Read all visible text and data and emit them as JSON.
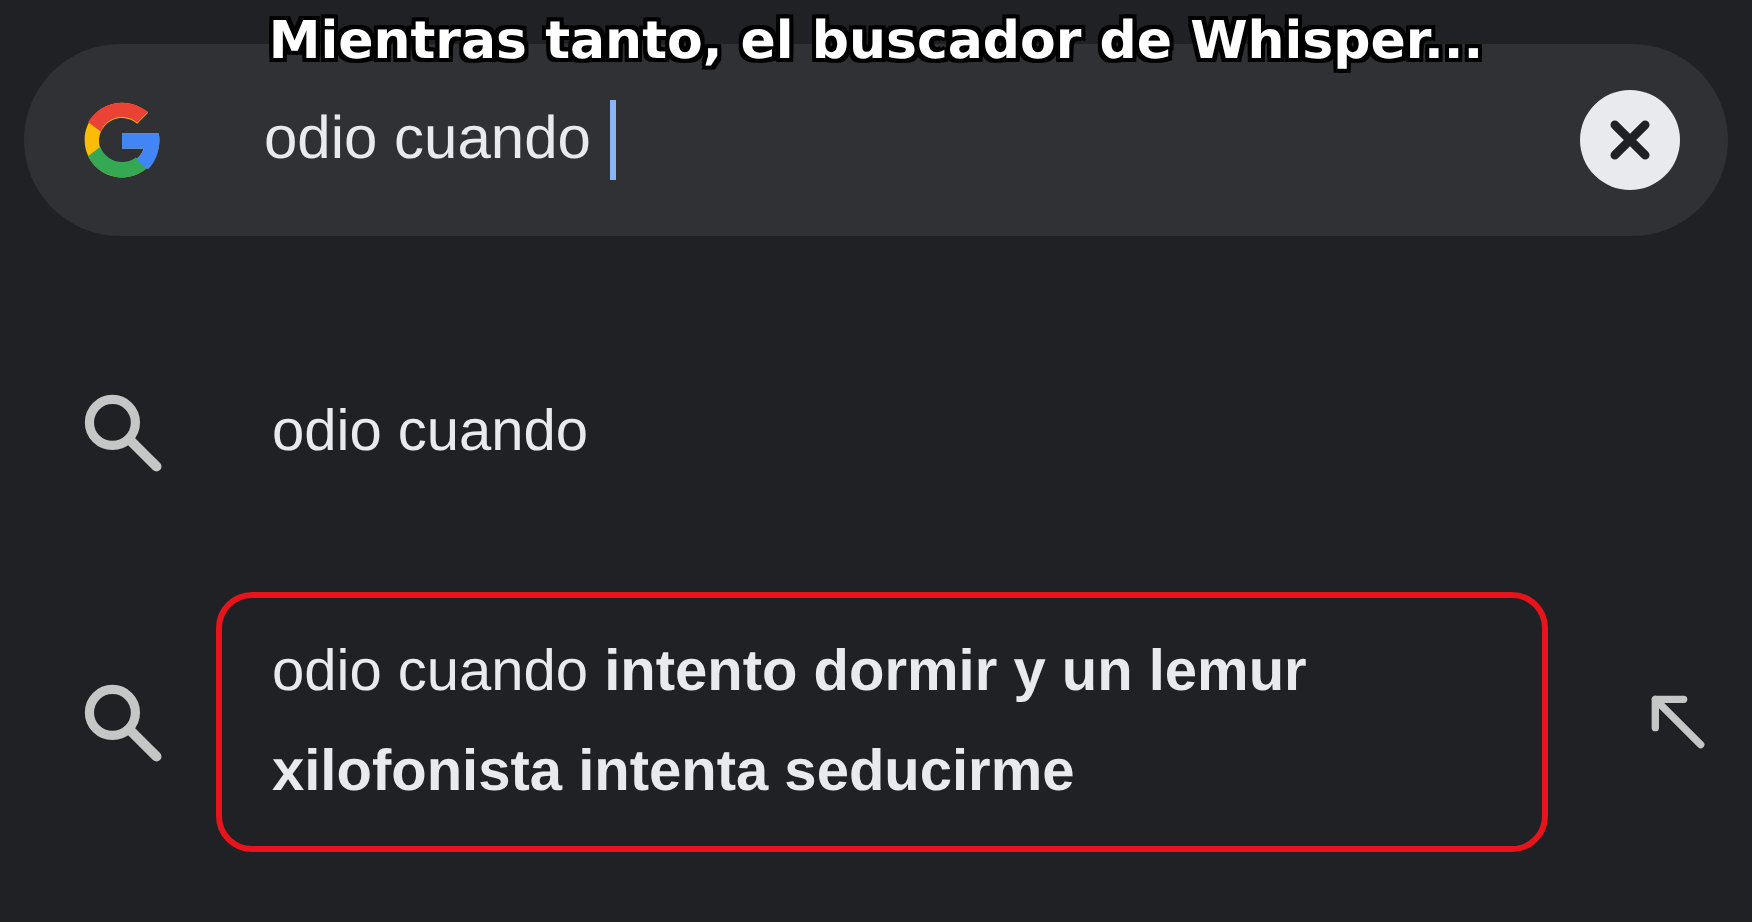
{
  "caption": "Mientras tanto, el buscador de Whisper...",
  "search": {
    "value": "odio cuando",
    "focused": true
  },
  "suggestions": [
    {
      "text": "odio cuando",
      "highlighted": false,
      "insert_arrow": false
    },
    {
      "text": "odio cuando **intento dormir y un lemur xilofonista intenta seducirme**",
      "highlighted": true,
      "insert_arrow": true
    }
  ]
}
